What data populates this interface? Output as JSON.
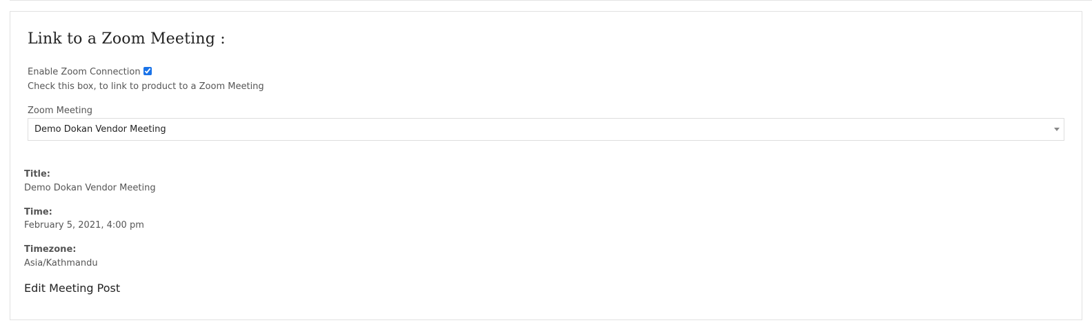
{
  "zoom_section": {
    "heading": "Link to a Zoom Meeting :",
    "enable_label": "Enable Zoom Connection",
    "enable_checked": true,
    "hint": "Check this box, to link to product to a Zoom Meeting",
    "meeting_label": "Zoom Meeting",
    "meeting_selected": "Demo Dokan Vendor Meeting"
  },
  "details": {
    "title_label": "Title:",
    "title_value": "Demo Dokan Vendor Meeting",
    "time_label": "Time:",
    "time_value": "February 5, 2021, 4:00 pm",
    "timezone_label": "Timezone:",
    "timezone_value": "Asia/Kathmandu"
  },
  "edit_link_label": "Edit Meeting Post",
  "icons": {
    "dropdown": "chevron-down-icon"
  },
  "colors": {
    "checkbox_accent": "#1a73e8",
    "panel_border": "#e1e1e1"
  }
}
